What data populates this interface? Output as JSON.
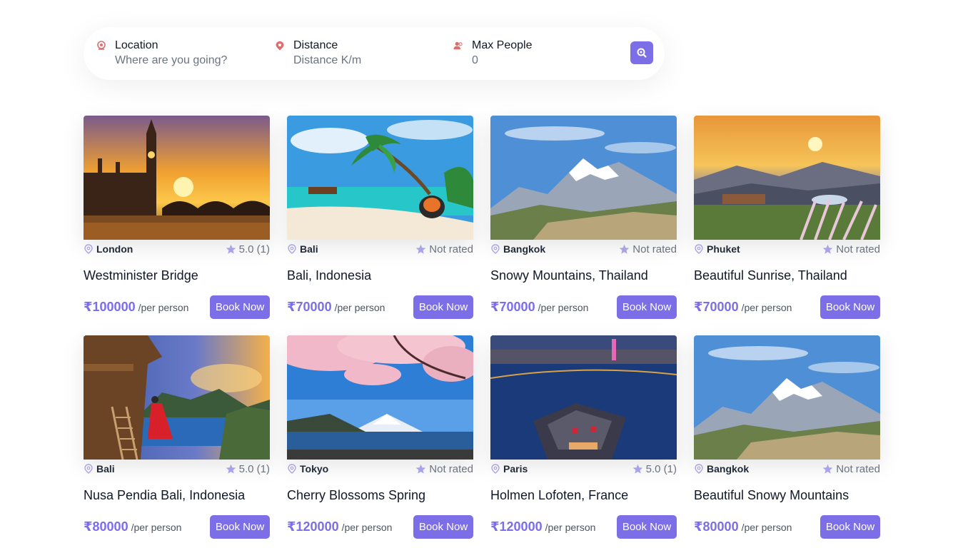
{
  "search": {
    "location": {
      "label": "Location",
      "placeholder": "Where are you going?"
    },
    "distance": {
      "label": "Distance",
      "placeholder": "Distance K/m"
    },
    "people": {
      "label": "Max People",
      "value": "0"
    },
    "icons": {
      "location": "location-pin-icon",
      "distance": "map-pin-icon",
      "people": "users-icon",
      "submit": "search-icon"
    }
  },
  "colors": {
    "accent": "#7c6ee6",
    "icon_red": "#e26d6d",
    "star": "#a9a3e8"
  },
  "book_label": "Book Now",
  "per_label": "/per person",
  "tours": [
    {
      "city": "London",
      "rating": "5.0 (1)",
      "title": "Westminister Bridge",
      "price": "₹100000"
    },
    {
      "city": "Bali",
      "rating": "Not rated",
      "title": "Bali, Indonesia",
      "price": "₹70000"
    },
    {
      "city": "Bangkok",
      "rating": "Not rated",
      "title": "Snowy Mountains, Thailand",
      "price": "₹70000"
    },
    {
      "city": "Phuket",
      "rating": "Not rated",
      "title": "Beautiful Sunrise, Thailand",
      "price": "₹70000"
    },
    {
      "city": "Bali",
      "rating": "5.0 (1)",
      "title": "Nusa Pendia Bali, Indonesia",
      "price": "₹80000"
    },
    {
      "city": "Tokyo",
      "rating": "Not rated",
      "title": "Cherry Blossoms Spring",
      "price": "₹120000"
    },
    {
      "city": "Paris",
      "rating": "5.0 (1)",
      "title": "Holmen Lofoten, France",
      "price": "₹120000"
    },
    {
      "city": "Bangkok",
      "rating": "Not rated",
      "title": "Beautiful Snowy Mountains",
      "price": "₹80000"
    }
  ]
}
